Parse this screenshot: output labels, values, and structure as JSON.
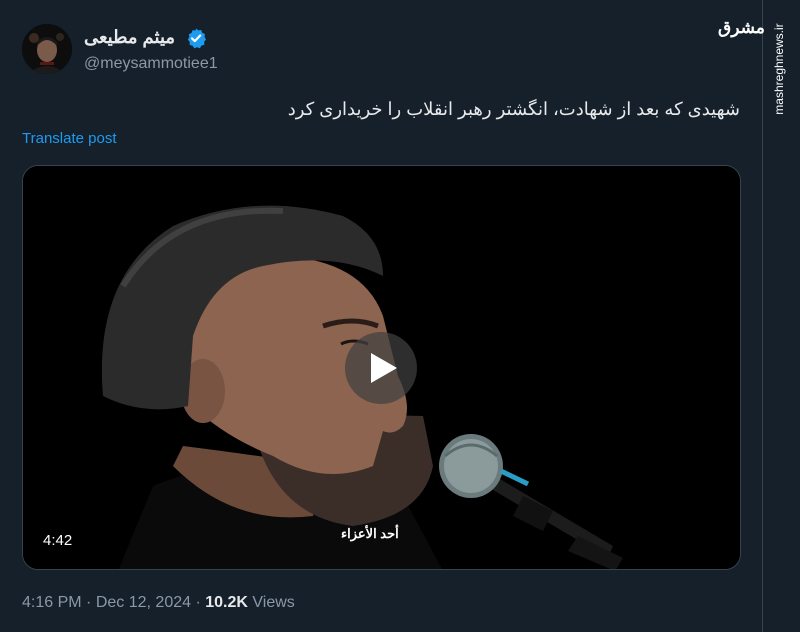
{
  "author": {
    "display_name": "میثم مطیعی",
    "handle": "@meysammotiee1",
    "verified": true
  },
  "tweet": {
    "text": "شهیدی که بعد از شهادت، انگشتر رهبر انقلاب را خریداری کرد",
    "translate_label": "Translate post"
  },
  "video": {
    "duration": "4:42",
    "caption": "أحد الأعزاء",
    "play_icon": "play-icon"
  },
  "meta": {
    "time": "4:16 PM",
    "separator": "·",
    "date": "Dec 12, 2024",
    "views_count": "10.2K",
    "views_label": "Views"
  },
  "watermark": {
    "logo_text": "مشرق",
    "site": "mashreghnews.ir"
  },
  "colors": {
    "background": "#15202b",
    "text": "#e7e9ea",
    "secondary": "#8b98a5",
    "accent": "#1d9bf0",
    "border": "#38444d"
  }
}
